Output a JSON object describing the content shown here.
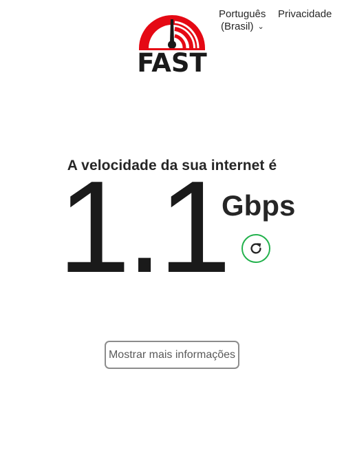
{
  "header": {
    "logo_text": "FAST",
    "language_line1": "Português",
    "language_line2": "(Brasil)",
    "privacy_label": "Privacidade"
  },
  "result": {
    "heading": "A velocidade da sua internet é",
    "speed_value": "1.1",
    "speed_unit": "Gbps",
    "refresh_icon": "refresh-icon"
  },
  "actions": {
    "more_info_label": "Mostrar mais informações"
  },
  "colors": {
    "logo_red": "#e50914",
    "refresh_green": "#22b14c",
    "text_dark": "#262626",
    "button_border": "#8c8c8c"
  }
}
